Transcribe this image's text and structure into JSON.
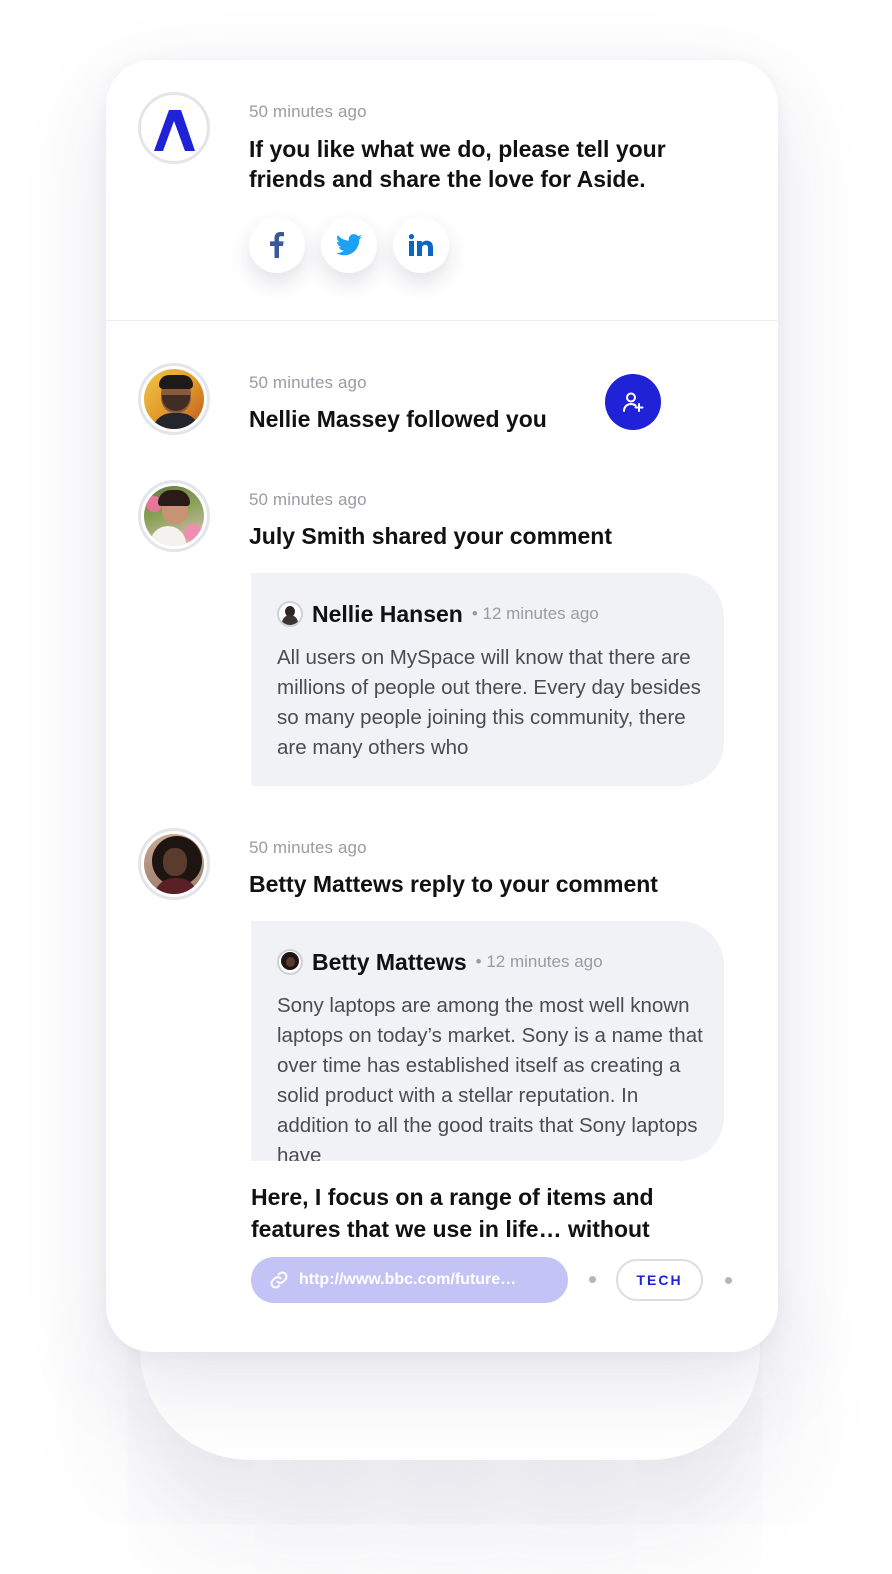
{
  "colors": {
    "accent": "#1f22d6",
    "link_pill": "#c4c3f6",
    "bubble_bg": "#f0f2f5",
    "facebook": "#3b5998",
    "twitter": "#1da1f2",
    "linkedin": "#0a66c2"
  },
  "notifications": [
    {
      "time": "50 minutes ago",
      "title": "If you like what we do, please tell your friends and share the love for Aside.",
      "avatar_icon": "aside-logo-icon"
    },
    {
      "time": "50 minutes ago",
      "title": "Nellie Massey followed you",
      "action_icon": "user-plus-icon"
    },
    {
      "time": "50 minutes ago",
      "title": "July Smith shared your comment",
      "comment": {
        "author": "Nellie Hansen",
        "time": "• 12 minutes ago",
        "text": "All users on MySpace will know that there are millions of people out there. Every day besides so many people joining this community, there are many others who"
      }
    },
    {
      "time": "50 minutes ago",
      "title": "Betty Mattews reply to your comment",
      "comment": {
        "author": "Betty Mattews",
        "time": "• 12 minutes ago",
        "text": "Sony laptops are among the most well known laptops on today’s market. Sony is a name that over time has established itself as creating a solid product with a stellar reputation. In addition to all the good traits that Sony laptops have"
      }
    }
  ],
  "share": {
    "icons": [
      "facebook-icon",
      "twitter-icon",
      "linkedin-icon"
    ]
  },
  "article": {
    "title": "Here, I focus on a range of items and features that we use in life… without",
    "link": "http://www.bbc.com/future…",
    "tag": "TECH"
  }
}
